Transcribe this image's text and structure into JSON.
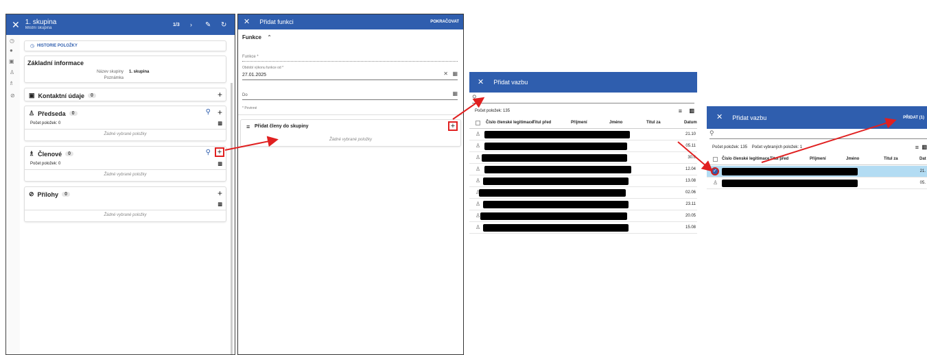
{
  "panel1": {
    "title": "1. skupina",
    "subtitle": "Místní skupina",
    "pager": "1/3",
    "history_label": "HISTORIE POLOŽKY",
    "basic_title": "Základní informace",
    "field_name_label": "Název skupiny",
    "field_name_value": "1. skupina",
    "field_note_label": "Poznámka",
    "contacts_title": "Kontaktní údaje",
    "contacts_count": "0",
    "chair_title": "Předseda",
    "chair_count": "0",
    "chair_items": "Počet položek: 0",
    "chair_empty": "Žádné vybrané položky",
    "members_title": "Členové",
    "members_count": "0",
    "members_items": "Počet položek: 0",
    "members_empty": "Žádné vybrané položky",
    "attach_title": "Přílohy",
    "attach_count": "0",
    "attach_empty": "Žádné vybrané položky"
  },
  "panel2": {
    "title": "Přidat funkci",
    "continue_label": "POKRAČOVAT",
    "section": "Funkce",
    "funkce_placeholder": "Funkce *",
    "from_label": "Období výkonu funkce od *",
    "from_value": "27.01.2025",
    "to_label": "Do",
    "required_note": "* Povinné",
    "add_members_title": "Přidat členy do skupiny",
    "add_members_empty": "Žádné vybrané položky"
  },
  "panel3": {
    "title": "Přidat vazbu",
    "count_label": "Počet položek: 135",
    "columns": [
      "Číslo členské legitimace",
      "Titul před",
      "Příjmení",
      "Jméno",
      "Titul za",
      "Datum"
    ],
    "dates": [
      "21.10",
      "05.11",
      "30.0",
      "12.04",
      "13.08",
      "02.06",
      "23.11",
      "20.05",
      "15.08"
    ]
  },
  "panel4": {
    "title": "Přidat vazbu",
    "add_label": "PŘIDAT (1)",
    "count_label": "Počet položek: 135",
    "selected_label": "Počet vybraných položek: 1",
    "columns": [
      "Číslo členské legitimace",
      "Titul před",
      "Příjmení",
      "Jméno",
      "Titul za",
      "Dat"
    ],
    "dates": [
      "21.",
      "05."
    ]
  },
  "icons": [
    "close-icon",
    "history-icon",
    "info-icon",
    "contact-card-icon",
    "person-icon",
    "group-icon",
    "attachment-icon",
    "edit-icon",
    "refresh-icon",
    "search-icon",
    "plus-icon",
    "columns-icon",
    "calendar-icon",
    "list-icon",
    "chevron-up-icon",
    "chevron-right-icon",
    "checkbox-icon"
  ],
  "colors": {
    "header": "#2f5eae",
    "highlight": "#b3dcf3",
    "arrow": "#e02020"
  }
}
